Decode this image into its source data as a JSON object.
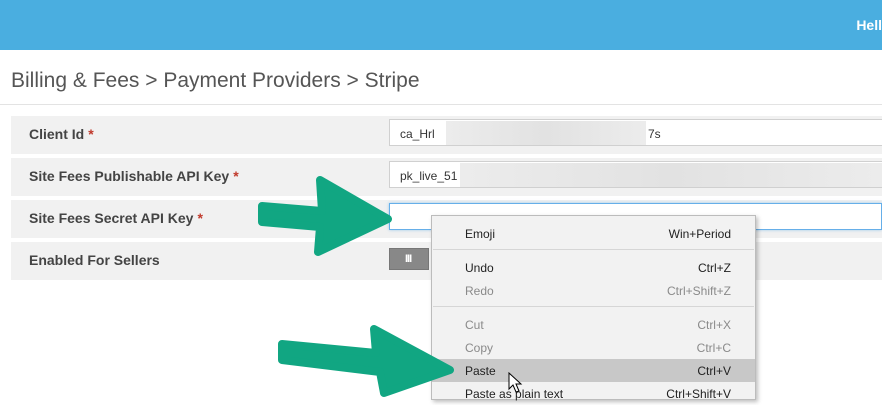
{
  "header": {
    "greeting": "Hell"
  },
  "breadcrumb": "Billing & Fees > Payment Providers > Stripe",
  "form": {
    "required_mark": "*",
    "client_id": {
      "label": "Client Id",
      "value_start": "ca_Hrl",
      "value_end": "7s"
    },
    "publishable_key": {
      "label": "Site Fees Publishable API Key",
      "value_start": "pk_live_51"
    },
    "secret_key": {
      "label": "Site Fees Secret API Key",
      "value": ""
    },
    "enabled": {
      "label": "Enabled For Sellers",
      "grip": "III"
    }
  },
  "context_menu": {
    "items": [
      {
        "label": "Emoji",
        "shortcut": "Win+Period",
        "enabled": true
      },
      {
        "label": "Undo",
        "shortcut": "Ctrl+Z",
        "enabled": true
      },
      {
        "label": "Redo",
        "shortcut": "Ctrl+Shift+Z",
        "enabled": false
      },
      {
        "label": "Cut",
        "shortcut": "Ctrl+X",
        "enabled": false
      },
      {
        "label": "Copy",
        "shortcut": "Ctrl+C",
        "enabled": false
      },
      {
        "label": "Paste",
        "shortcut": "Ctrl+V",
        "enabled": true,
        "highlighted": true
      },
      {
        "label": "Paste as plain text",
        "shortcut": "Ctrl+Shift+V",
        "enabled": true
      }
    ]
  },
  "colors": {
    "header": "#4aaee0",
    "arrow": "#11a682",
    "required": "#c0392b",
    "focus": "#66afe9"
  }
}
